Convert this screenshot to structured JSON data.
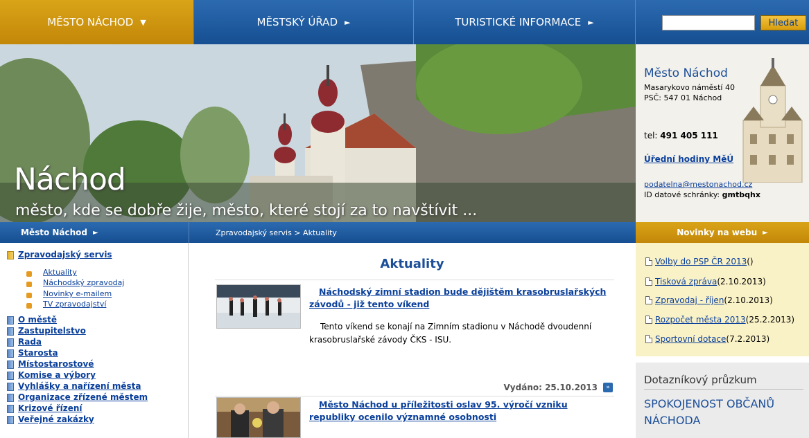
{
  "topnav": {
    "tab1": "MĚSTO NÁCHOD",
    "tab1_arrow": "▼",
    "tab2": "MĚSTSKÝ ÚŘAD",
    "tab3": "TURISTICKÉ INFORMACE",
    "arrow": "►",
    "search_placeholder": "",
    "search_button": "Hledat"
  },
  "hero": {
    "title": "Náchod",
    "slogan": "město, kde se dobře žije, město, které stojí za to navštívit ..."
  },
  "contact": {
    "title": "Město Náchod",
    "address1": "Masarykovo náměstí 40",
    "address2": "PSČ: 547 01 Náchod",
    "tel_label": "tel: ",
    "tel": "491 405 111",
    "hours": "Úřední hodiny MěÚ",
    "email": "podatelna@mestonachod.cz",
    "ds_label": "ID datové schránky: ",
    "ds": "gmtbqhx"
  },
  "bars": {
    "left": "Město Náchod",
    "middle": "Zpravodajský servis > Aktuality",
    "right": "Novinky na webu",
    "arrow": "►"
  },
  "leftmenu": {
    "section": "Zpravodajský servis",
    "subitems": [
      "Aktuality",
      "Náchodský zpravodaj",
      "Novinky e-mailem",
      "TV zpravodajství"
    ],
    "items": [
      "O městě",
      "Zastupitelstvo",
      "Rada",
      "Starosta",
      "Místostarostové",
      "Komise a výbory",
      "Vyhlášky a nařízení města",
      "Organizace zřízené městem",
      "Krizové řízení",
      "Veřejné zakázky"
    ]
  },
  "main": {
    "heading": "Aktuality",
    "articles": [
      {
        "title": "Náchodský zimní stadion bude dějištěm krasobruslařských závodů - již tento víkend",
        "text": "Tento víkend se konají na Zimním stadionu v Náchodě dvoudenní krasobruslařské závody ČKS - ISU.",
        "date": "Vydáno: 25.10.2013",
        "more": "»"
      },
      {
        "title": "Město Náchod u příležitosti oslav 95. výročí vzniku republiky ocenilo významné osobnosti",
        "text": ""
      }
    ]
  },
  "news": {
    "items": [
      {
        "link": "Volby do PSP ČR 2013",
        "suffix": " ()"
      },
      {
        "link": "Tisková zpráva",
        "suffix": " (2.10.2013)"
      },
      {
        "link": "Zpravodaj - říjen",
        "suffix": " (2.10.2013)"
      },
      {
        "link": "Rozpočet města 2013",
        "suffix": " (25.2.2013)"
      },
      {
        "link": "Sportovní dotace",
        "suffix": " (7.2.2013)"
      }
    ]
  },
  "survey": {
    "title": "Dotazníkový průzkum",
    "subtitle": "SPOKOJENOST OBČANŮ NÁCHODA"
  },
  "colors": {
    "gold": "#d9a418",
    "blue": "#1d5aa0",
    "link": "#0a3f9a",
    "news_bg": "#faf2c7"
  }
}
